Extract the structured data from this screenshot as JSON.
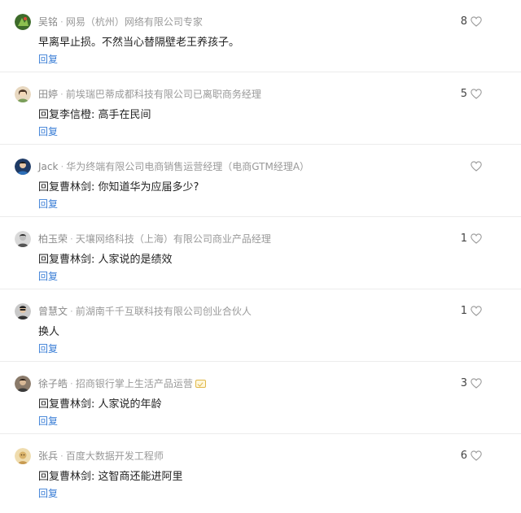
{
  "comments": [
    {
      "name": "吴铭",
      "title": "网易（杭州）网络有限公司专家",
      "content": "早离早止损。不然当心替隔壁老王养孩子。",
      "reply_label": "回复",
      "likes": "8",
      "avatar_color": "#5a8f3c",
      "verified": false
    },
    {
      "name": "田婷",
      "title": "前埃瑞巴蒂成都科技有限公司已离职商务经理",
      "content": "回复李信橙: 高手在民间",
      "reply_label": "回复",
      "likes": "5",
      "avatar_color": "#c59a5a",
      "verified": false
    },
    {
      "name": "Jack",
      "title": "华为终端有限公司电商销售运营经理（电商GTM经理A）",
      "content": "回复曹林剑: 你知道华为应届多少?",
      "reply_label": "回复",
      "likes": "",
      "avatar_color": "#2c4a7a",
      "verified": false
    },
    {
      "name": "柏玉荣",
      "title": "天壤网络科技（上海）有限公司商业产品经理",
      "content": "回复曹林剑: 人家说的是绩效",
      "reply_label": "回复",
      "likes": "1",
      "avatar_color": "#9a9a9a",
      "verified": false
    },
    {
      "name": "曾慧文",
      "title": "前湖南千千互联科技有限公司创业合伙人",
      "content": "换人",
      "reply_label": "回复",
      "likes": "1",
      "avatar_color": "#4a4a4a",
      "verified": false
    },
    {
      "name": "徐子皓",
      "title": "招商银行掌上生活产品运营",
      "content": "回复曹林剑: 人家说的年龄",
      "reply_label": "回复",
      "likes": "3",
      "avatar_color": "#6b5a4a",
      "verified": true
    },
    {
      "name": "张兵",
      "title": "百度大数据开发工程师",
      "content": "回复曹林剑: 这智商还能进阿里",
      "reply_label": "回复",
      "likes": "6",
      "avatar_color": "#d8b878",
      "verified": false
    }
  ]
}
